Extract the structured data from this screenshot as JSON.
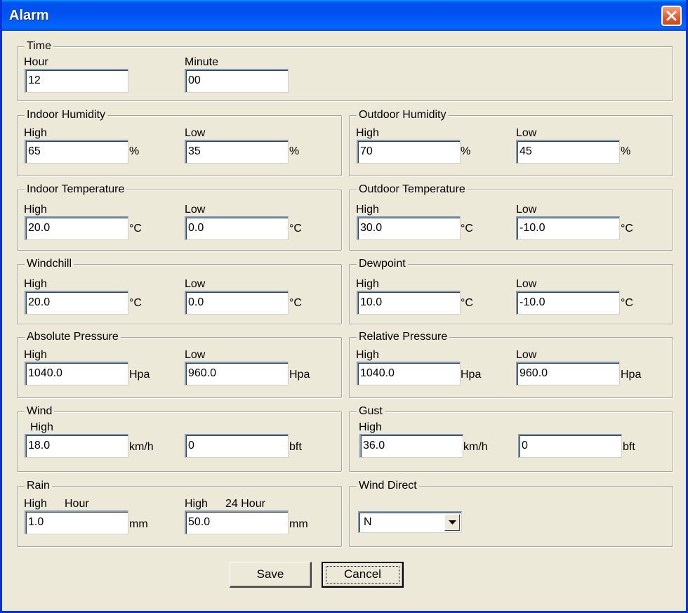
{
  "window": {
    "title": "Alarm"
  },
  "common": {
    "high": "High",
    "low": "Low"
  },
  "time": {
    "legend": "Time",
    "hour_label": "Hour",
    "hour_value": "12",
    "minute_label": "Minute",
    "minute_value": "00"
  },
  "indoor_humidity": {
    "legend": "Indoor Humidity",
    "high_value": "65",
    "low_value": "35",
    "unit": "%"
  },
  "outdoor_humidity": {
    "legend": "Outdoor Humidity",
    "high_value": "70",
    "low_value": "45",
    "unit": "%"
  },
  "indoor_temperature": {
    "legend": "Indoor Temperature",
    "high_value": "20.0",
    "low_value": "0.0",
    "unit": "°C"
  },
  "outdoor_temperature": {
    "legend": "Outdoor Temperature",
    "high_value": "30.0",
    "low_value": "-10.0",
    "unit": "°C"
  },
  "windchill": {
    "legend": "Windchill",
    "high_value": "20.0",
    "low_value": "0.0",
    "unit": "°C"
  },
  "dewpoint": {
    "legend": "Dewpoint",
    "high_value": "10.0",
    "low_value": "-10.0",
    "unit": "°C"
  },
  "absolute_pressure": {
    "legend": "Absolute Pressure",
    "high_value": "1040.0",
    "low_value": "960.0",
    "unit": "Hpa"
  },
  "relative_pressure": {
    "legend": "Relative Pressure",
    "high_value": "1040.0",
    "low_value": "960.0",
    "unit": "Hpa"
  },
  "wind": {
    "legend": "Wind",
    "high_label": "High",
    "speed_value": "18.0",
    "speed_unit": "km/h",
    "bft_value": "0",
    "bft_unit": "bft"
  },
  "gust": {
    "legend": "Gust",
    "high_label": "High",
    "speed_value": "36.0",
    "speed_unit": "km/h",
    "bft_value": "0",
    "bft_unit": "bft"
  },
  "rain": {
    "legend": "Rain",
    "hour_high_label": "High",
    "hour_label": "Hour",
    "hour_value": "1.0",
    "day_high_label": "High",
    "day_label": "24 Hour",
    "day_value": "50.0",
    "unit": "mm"
  },
  "wind_direct": {
    "legend": "Wind Direct",
    "selected": "N"
  },
  "buttons": {
    "save": "Save",
    "cancel": "Cancel"
  }
}
